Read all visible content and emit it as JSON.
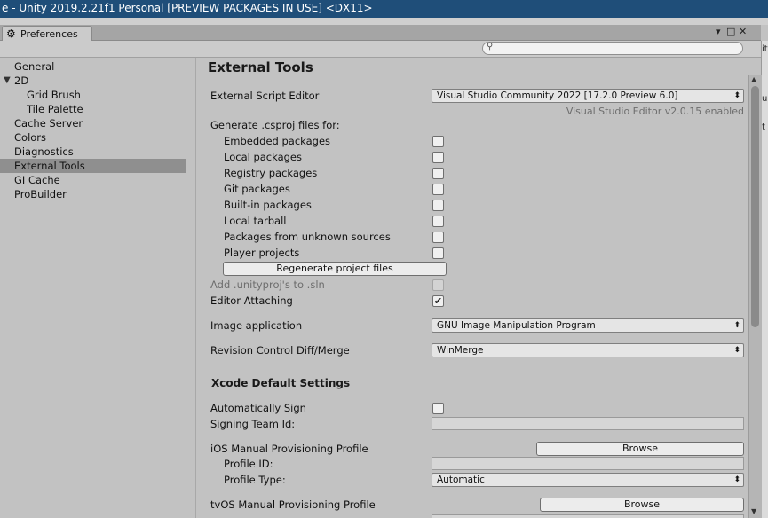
{
  "title_bar": {
    "text": "e - Unity 2019.2.21f1 Personal [PREVIEW PACKAGES IN USE] <DX11>"
  },
  "right_peek": {
    "glyph_1": "it",
    "glyph_2": "u",
    "glyph_3": "t"
  },
  "window": {
    "tab_label": "Preferences",
    "controls": {
      "menu": "▾",
      "maximize": "□",
      "close": "✕"
    }
  },
  "sidebar": {
    "items": [
      {
        "label": "General"
      },
      {
        "label": "2D"
      },
      {
        "label": "Grid Brush"
      },
      {
        "label": "Tile Palette"
      },
      {
        "label": "Cache Server"
      },
      {
        "label": "Colors"
      },
      {
        "label": "Diagnostics"
      },
      {
        "label": "External Tools"
      },
      {
        "label": "GI Cache"
      },
      {
        "label": "ProBuilder"
      }
    ],
    "selected": "External Tools"
  },
  "content": {
    "heading": "External Tools",
    "script_editor": {
      "label": "External Script Editor",
      "value": "Visual Studio Community 2022 [17.2.0 Preview 6.0]",
      "note": "Visual Studio Editor v2.0.15 enabled"
    },
    "generate": {
      "label": "Generate .csproj files for:",
      "options": [
        {
          "label": "Embedded packages",
          "checked": false
        },
        {
          "label": "Local packages",
          "checked": false
        },
        {
          "label": "Registry packages",
          "checked": false
        },
        {
          "label": "Git packages",
          "checked": false
        },
        {
          "label": "Built-in packages",
          "checked": false
        },
        {
          "label": "Local tarball",
          "checked": false
        },
        {
          "label": "Packages from unknown sources",
          "checked": false
        },
        {
          "label": "Player projects",
          "checked": false
        }
      ],
      "regenerate_label": "Regenerate project files"
    },
    "add_unityproj": {
      "label": "Add .unityproj's to .sln",
      "checked": false,
      "enabled": false
    },
    "editor_attaching": {
      "label": "Editor Attaching",
      "checked": true,
      "check_glyph": "✔"
    },
    "image_application": {
      "label": "Image application",
      "value": "GNU Image Manipulation Program"
    },
    "revision_control": {
      "label": "Revision Control Diff/Merge",
      "value": "WinMerge"
    },
    "xcode": {
      "heading": "Xcode Default Settings",
      "auto_sign": {
        "label": "Automatically Sign",
        "checked": false
      },
      "signing_team": {
        "label": "Signing Team Id:",
        "value": ""
      },
      "ios_profile": {
        "label": "iOS Manual Provisioning Profile",
        "browse_label": "Browse",
        "profile_id_label": "Profile ID:",
        "profile_id_value": "",
        "profile_type_label": "Profile Type:",
        "profile_type_value": "Automatic"
      },
      "tvos_profile": {
        "label": "tvOS Manual Provisioning Profile",
        "browse_label": "Browse"
      }
    }
  },
  "glyphs": {
    "dropdown_arrow": "⬍",
    "expanded_triangle": "▼",
    "scroll_up": "▲",
    "scroll_down": "▼"
  }
}
